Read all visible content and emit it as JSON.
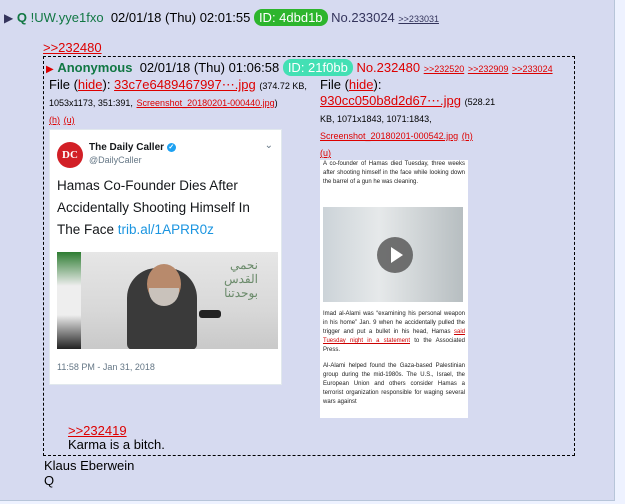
{
  "post": {
    "tripcode": "!UW.yye1fxo",
    "name": "Q",
    "datetime": "02/01/18 (Thu) 02:01:55",
    "id_label": "ID: 4dbd1b",
    "id_color": "#2db52d",
    "number": "No.233024",
    "backlink": ">>233031",
    "quote_ref": ">>232480",
    "signature_line1": "Klaus Eberwein",
    "signature_line2": "Q"
  },
  "quoted_post": {
    "name": "Anonymous",
    "datetime": "02/01/18 (Thu) 01:06:58",
    "id_label": "ID: 21f0bb",
    "id_color": "#43e0b4",
    "number": "No.232480",
    "backlinks": [
      ">>232520",
      ">>232909",
      ">>233024"
    ],
    "file1": {
      "label": "File",
      "hide": "hide",
      "filename": "33c7e6489467997⋯.jpg",
      "meta": "(374.72 KB, 1053x1173, 351:391,",
      "original_name": "Screenshot_20180201-000440.jpg",
      "meta_end": ")",
      "h": "(h)",
      "u": "(u)"
    },
    "file2": {
      "label": "File",
      "hide": "hide",
      "filename": "930cc050b8d2d67⋯.jpg",
      "meta": "(528.21 KB, 1071x1843, 1071:1843,",
      "original_name": "Screenshot_20180201-000542.jpg",
      "h": "(h)",
      "u": "(u)"
    },
    "tweet": {
      "logo": "DC",
      "account_name": "The Daily Caller",
      "handle": "@DailyCaller",
      "text": "Hamas Co-Founder Dies After Accidentally Shooting Himself In The Face",
      "link": "trib.al/1APRR0z",
      "photo_arabic_line1": "نحمي",
      "photo_arabic_line2": "القدس",
      "photo_arabic_line3": "بوحدتنا",
      "timestamp": "11:58 PM - Jan 31, 2018"
    },
    "article": {
      "p1": "A co-founder of Hamas died Tuesday, three weeks after shooting himself in the face while looking down the barrel of a gun he was cleaning.",
      "p2_a": "Imad al-Alami was “examining his personal weapon in his home” Jan. 9 when he accidentally pulled the trigger and put a bullet in his head, Hamas ",
      "p2_link": "said Tuesday night in a statement",
      "p2_b": " to the Associated Press.",
      "p3": "Al-Alami helped found the Gaza-based Palestinian group during the mid-1980s. The U.S., Israel, the European Union and others consider Hamas a terrorist organization responsible for waging several wars against"
    },
    "reply_ref": ">>232419",
    "reply_text": "Karma is a bitch."
  }
}
